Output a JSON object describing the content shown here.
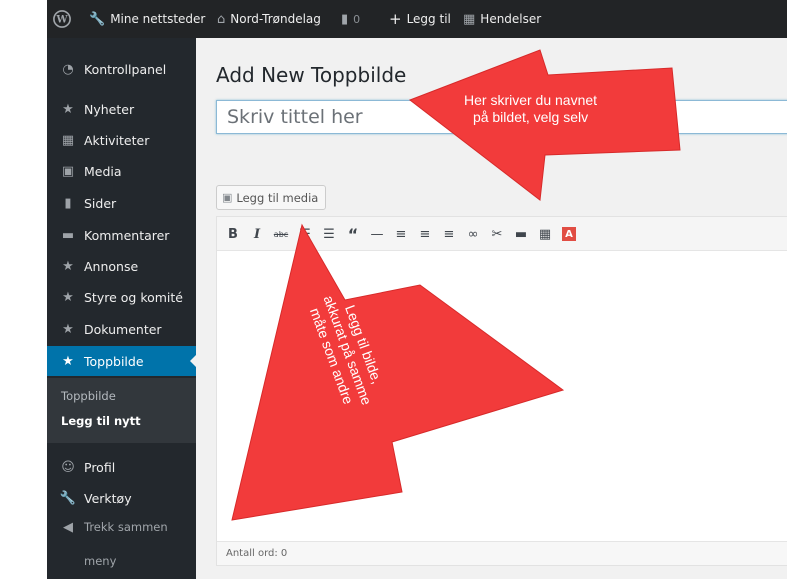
{
  "adminbar": {
    "my_sites": "Mine nettsteder",
    "site_name": "Nord-Trøndelag",
    "comments_count": "0",
    "add_new": "Legg til",
    "events": "Hendelser"
  },
  "sidebar": {
    "items": [
      {
        "label": "Kontrollpanel",
        "icon": "dashboard-icon"
      },
      {
        "label": "Nyheter",
        "icon": "pin-icon"
      },
      {
        "label": "Aktiviteter",
        "icon": "calendar-icon"
      },
      {
        "label": "Media",
        "icon": "media-icon"
      },
      {
        "label": "Sider",
        "icon": "page-icon"
      },
      {
        "label": "Kommentarer",
        "icon": "comment-icon"
      },
      {
        "label": "Annonse",
        "icon": "pin-icon"
      },
      {
        "label": "Styre og komité",
        "icon": "pin-icon"
      },
      {
        "label": "Dokumenter",
        "icon": "pin-icon"
      },
      {
        "label": "Toppbilde",
        "icon": "pin-icon"
      },
      {
        "label": "Profil",
        "icon": "user-icon"
      },
      {
        "label": "Verktøy",
        "icon": "wrench-icon"
      }
    ],
    "submenu": [
      "Toppbilde",
      "Legg til nytt"
    ],
    "collapse": [
      "Trekk sammen",
      "meny"
    ]
  },
  "main": {
    "title": "Add New Toppbilde",
    "title_placeholder": "Skriv tittel her",
    "add_media": "Legg til media",
    "word_count": "Antall ord: 0",
    "toolbar_color_glyph": "A"
  },
  "annotations": {
    "top": [
      "Her skriver du navnet",
      "på bildet, velg selv"
    ],
    "bottom": [
      "Legg til bilde,",
      "akkurat på samme",
      "måte som andre"
    ]
  },
  "colors": {
    "adminbar_bg": "#222426",
    "sidebar_bg": "#23282d",
    "current_menu": "#0073aa",
    "annotation": "#f23b3b"
  }
}
